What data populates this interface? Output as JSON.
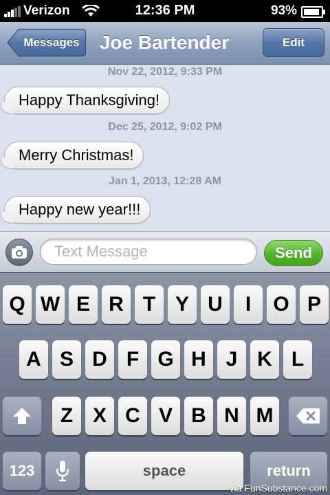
{
  "status_bar": {
    "carrier": "Verizon",
    "time": "12:36 PM",
    "battery_percent": "93%",
    "battery_level": 0.93,
    "signal_icon": "signal-bars-icon",
    "wifi_icon": "wifi-icon"
  },
  "nav": {
    "back_label": "Messages",
    "title": "Joe Bartender",
    "edit_label": "Edit"
  },
  "messages": [
    {
      "timestamp": "Nov 22, 2012, 9:33 PM",
      "text": "Happy Thanksgiving!"
    },
    {
      "timestamp": "Dec 25, 2012, 9:02 PM",
      "text": "Merry Christmas!"
    },
    {
      "timestamp": "Jan 1, 2013, 12:28 AM",
      "text": "Happy new year!!!"
    }
  ],
  "compose": {
    "camera_icon": "camera-icon",
    "placeholder": "Text Message",
    "value": "",
    "send_label": "Send"
  },
  "keyboard": {
    "row1": [
      "Q",
      "W",
      "E",
      "R",
      "T",
      "Y",
      "U",
      "I",
      "O",
      "P"
    ],
    "row2": [
      "A",
      "S",
      "D",
      "F",
      "G",
      "H",
      "J",
      "K",
      "L"
    ],
    "row3": [
      "Z",
      "X",
      "C",
      "V",
      "B",
      "N",
      "M"
    ],
    "numbers_label": "123",
    "space_label": "space",
    "return_label": "return",
    "shift_icon": "shift-icon",
    "backspace_icon": "backspace-icon",
    "mic_icon": "microphone-icon"
  },
  "watermark": "via FunSubstance.com",
  "colors": {
    "nav_blue": "#8ea2bd",
    "send_green": "#52b52b",
    "background": "#dbe2ed"
  }
}
